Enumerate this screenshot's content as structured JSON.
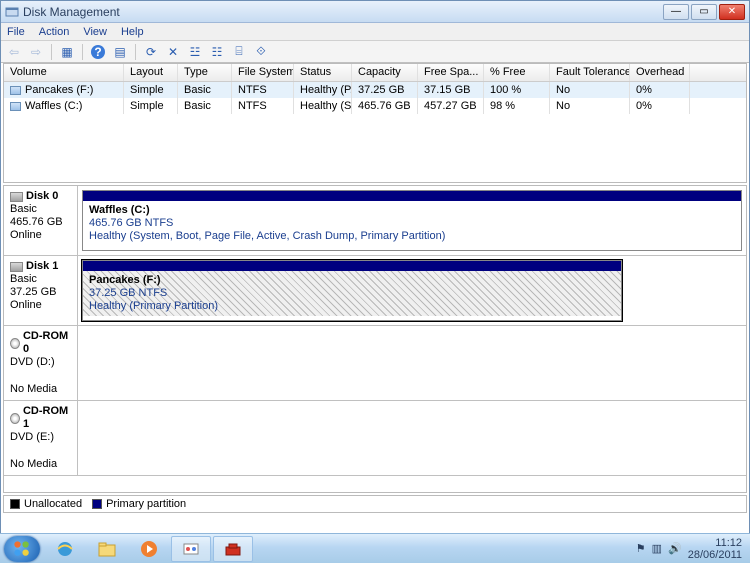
{
  "window": {
    "title": "Disk Management"
  },
  "menu": {
    "file": "File",
    "action": "Action",
    "view": "View",
    "help": "Help"
  },
  "volumes": {
    "headers": {
      "volume": "Volume",
      "layout": "Layout",
      "type": "Type",
      "fs": "File System",
      "status": "Status",
      "capacity": "Capacity",
      "free": "Free Spa...",
      "pct": "% Free",
      "fault": "Fault Tolerance",
      "over": "Overhead"
    },
    "rows": [
      {
        "name": "Pancakes (F:)",
        "layout": "Simple",
        "type": "Basic",
        "fs": "NTFS",
        "status": "Healthy (P...",
        "capacity": "37.25 GB",
        "free": "37.15 GB",
        "pct": "100 %",
        "fault": "No",
        "over": "0%",
        "selected": true
      },
      {
        "name": "Waffles (C:)",
        "layout": "Simple",
        "type": "Basic",
        "fs": "NTFS",
        "status": "Healthy (S...",
        "capacity": "465.76 GB",
        "free": "457.27 GB",
        "pct": "98 %",
        "fault": "No",
        "over": "0%",
        "selected": false
      }
    ]
  },
  "disks": [
    {
      "kind": "disk",
      "label": "Disk 0",
      "type": "Basic",
      "size": "465.76 GB",
      "state": "Online",
      "parts": [
        {
          "name": "Waffles  (C:)",
          "info": "465.76 GB NTFS",
          "status": "Healthy (System, Boot, Page File, Active, Crash Dump, Primary Partition)",
          "wide": true,
          "hatched": false,
          "selected": false
        }
      ]
    },
    {
      "kind": "disk",
      "label": "Disk 1",
      "type": "Basic",
      "size": "37.25 GB",
      "state": "Online",
      "parts": [
        {
          "name": "Pancakes  (F:)",
          "info": "37.25 GB NTFS",
          "status": "Healthy (Primary Partition)",
          "wide": false,
          "hatched": true,
          "selected": true
        }
      ]
    },
    {
      "kind": "cd",
      "label": "CD-ROM 0",
      "type": "DVD (D:)",
      "size": "",
      "state": "No Media",
      "parts": []
    },
    {
      "kind": "cd",
      "label": "CD-ROM 1",
      "type": "DVD (E:)",
      "size": "",
      "state": "No Media",
      "parts": []
    }
  ],
  "legend": {
    "unallocated": "Unallocated",
    "primary": "Primary partition"
  },
  "tray": {
    "time": "11:12",
    "date": "28/06/2011"
  }
}
